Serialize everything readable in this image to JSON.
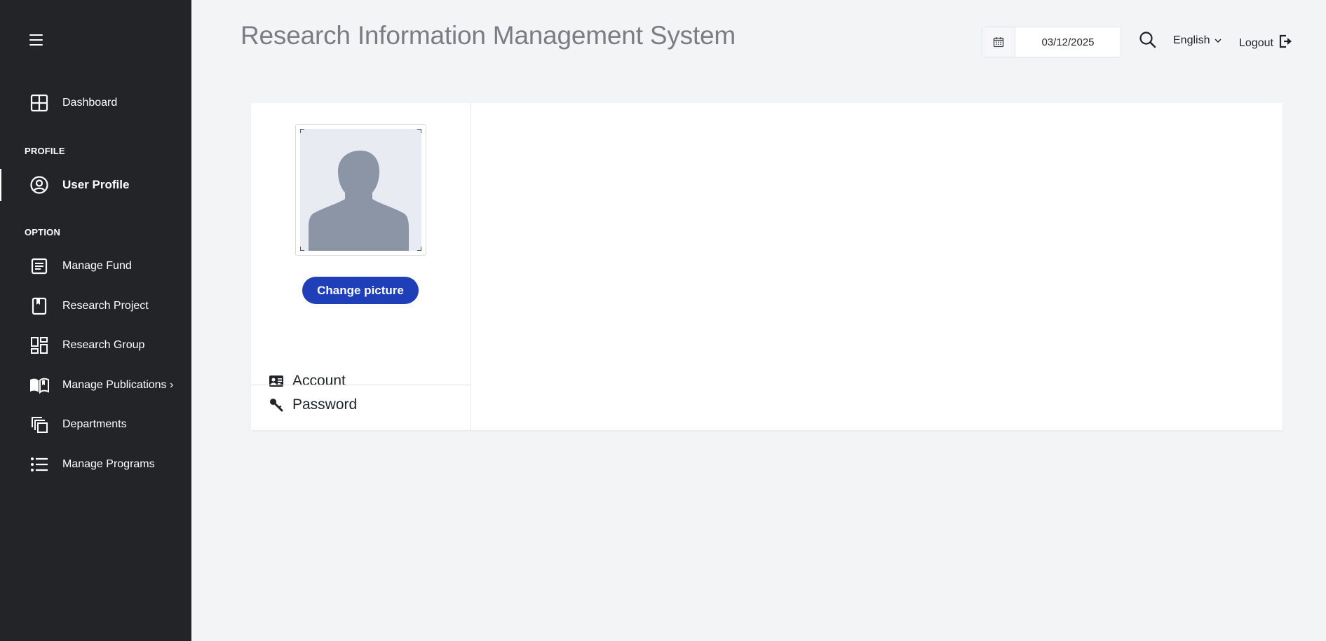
{
  "sidebar": {
    "menu_icon": "hamburger-icon",
    "items": [
      {
        "label": "Dashboard",
        "icon": "dashboard-grid-icon"
      },
      {
        "label": "User Profile",
        "icon": "user-circle-icon",
        "active": true
      },
      {
        "label": "Manage Fund",
        "icon": "document-icon"
      },
      {
        "label": "Research Project",
        "icon": "bookmark-book-icon"
      },
      {
        "label": "Research Group",
        "icon": "group-grid-icon"
      },
      {
        "label": "Manage Publications ›",
        "icon": "open-book-icon"
      },
      {
        "label": "Departments",
        "icon": "copy-stack-icon"
      },
      {
        "label": "Manage Programs",
        "icon": "list-icon"
      }
    ],
    "sections": {
      "profile": "PROFILE",
      "option": "OPTION"
    }
  },
  "header": {
    "title": "Research Information Management System",
    "date": "03/12/2025",
    "language": "English",
    "logout_label": "Logout"
  },
  "profile_card": {
    "change_picture_label": "Change picture",
    "menu": [
      {
        "label": "Account",
        "icon": "id-card-icon"
      },
      {
        "label": "Password",
        "icon": "key-icon"
      }
    ]
  },
  "colors": {
    "sidebar_bg": "#232428",
    "page_bg": "#f3f4f6",
    "accent": "#1f3fb8",
    "avatar_silhouette": "#8b95a5",
    "avatar_bg": "#e9ebf3"
  }
}
